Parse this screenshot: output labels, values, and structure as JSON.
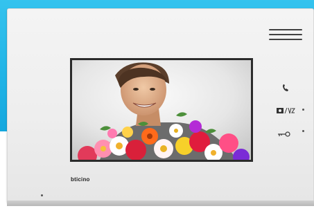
{
  "device": {
    "brand": "bticino",
    "accent_color": "#1fb3e6",
    "speaker_icon": "speaker-grille-icon",
    "controls": [
      {
        "icon": "handset-icon"
      },
      {
        "icon": "camera-switch-icon"
      },
      {
        "icon": "key-icon"
      }
    ],
    "screen": {
      "content": "photo"
    }
  }
}
